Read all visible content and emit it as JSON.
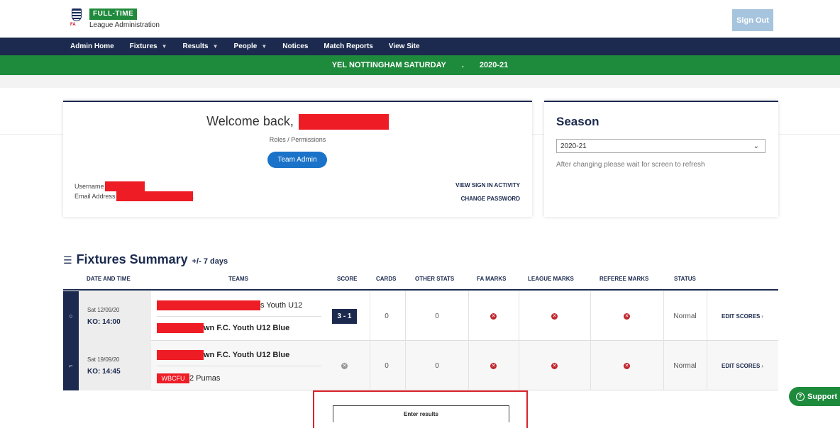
{
  "header": {
    "brand_badge": "FULL-TIME",
    "brand_sub": "League Administration",
    "crest_text": "FA",
    "signout_label": "Sign Out"
  },
  "nav": {
    "items": [
      {
        "label": "Admin Home",
        "dropdown": false
      },
      {
        "label": "Fixtures",
        "dropdown": true
      },
      {
        "label": "Results",
        "dropdown": true
      },
      {
        "label": "People",
        "dropdown": true
      },
      {
        "label": "Notices",
        "dropdown": false
      },
      {
        "label": "Match Reports",
        "dropdown": false
      },
      {
        "label": "View Site",
        "dropdown": false
      }
    ],
    "caret": "▼"
  },
  "league_bar": {
    "league": "YEL NOTTINGHAM SATURDAY",
    "separator": ".",
    "season": "2020-21"
  },
  "welcome": {
    "title": "Welcome back,",
    "roles_label": "Roles / Permissions",
    "role_button": "Team Admin",
    "username_label": "Username",
    "email_label": "Email Address",
    "email_suffix": ".",
    "view_activity": "VIEW SIGN IN ACTIVITY",
    "change_password": "CHANGE PASSWORD"
  },
  "season": {
    "title": "Season",
    "selected": "2020-21",
    "help": "After changing please wait for screen to refresh",
    "chevron": "⌄"
  },
  "fixtures": {
    "title": "Fixtures Summary",
    "subtitle": "+/- 7 days",
    "list_icon": "☰",
    "columns": {
      "date": "DATE AND TIME",
      "teams": "TEAMS",
      "score": "SCORE",
      "cards": "CARDS",
      "other": "OTHER STATS",
      "fa": "FA MARKS",
      "league": "LEAGUE MARKS",
      "referee": "REFEREE MARKS",
      "status": "STATUS"
    },
    "rows": [
      {
        "side": "○",
        "date": "Sat 12/09/20",
        "ko": "KO: 14:00",
        "home_team": "s Youth U12",
        "away_team": "wn F.C. Youth U12 Blue",
        "score": "3 - 1",
        "cards": "0",
        "other": "0",
        "status": "Normal",
        "edit": "EDIT SCORES",
        "mark": "✕",
        "chevron": "›"
      },
      {
        "side": "⌐",
        "date": "Sat 19/09/20",
        "ko": "KO: 14:45",
        "home_team": "wn F.C. Youth U12 Blue",
        "away_team": "2 Pumas",
        "away_partial": "WBCFU",
        "score_icon": "✕",
        "cards": "0",
        "other": "0",
        "status": "Normal",
        "edit": "EDIT SCORES",
        "mark": "✕",
        "chevron": "›"
      }
    ]
  },
  "enter_results": "Enter results",
  "support": {
    "label": "Support",
    "icon": "?"
  },
  "colors": {
    "navy": "#1b2a4e",
    "green": "#1e8a3c",
    "redaction": "#ee1c24",
    "mark_red": "#c0272d",
    "button_blue": "#1a73c8"
  }
}
